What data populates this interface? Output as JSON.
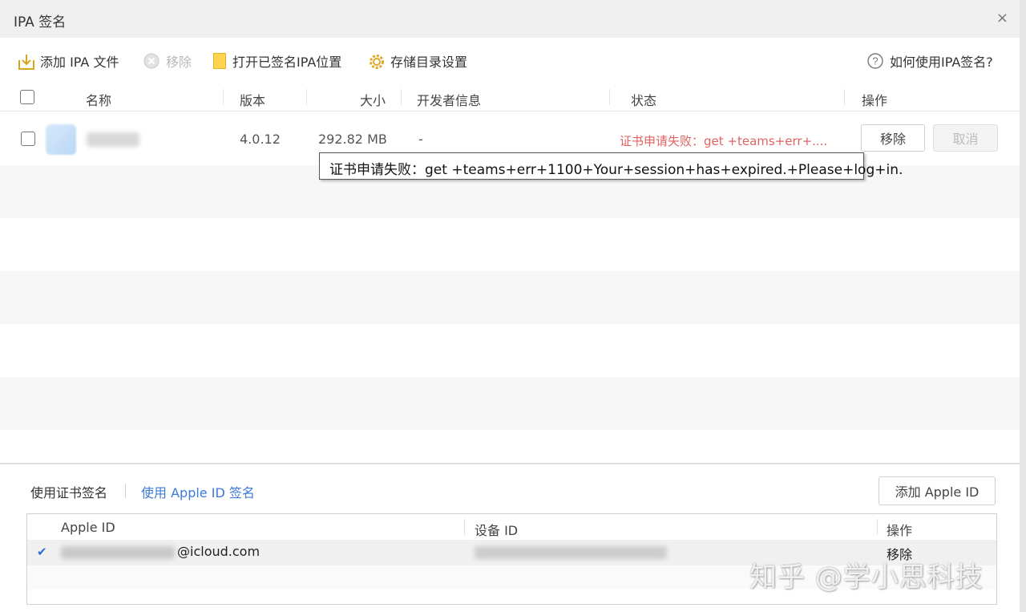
{
  "window": {
    "title": "IPA 签名",
    "close_glyph": "×"
  },
  "toolbar": {
    "add_ipa": "添加 IPA 文件",
    "remove": "移除",
    "open_signed_location": "打开已签名IPA位置",
    "storage_settings": "存储目录设置",
    "help": "如何使用IPA签名?"
  },
  "table": {
    "headers": {
      "name": "名称",
      "version": "版本",
      "size": "大小",
      "developer": "开发者信息",
      "status": "状态",
      "actions": "操作"
    },
    "rows": [
      {
        "version": "4.0.12",
        "size": "292.82 MB",
        "developer": "-",
        "status": "证书申请失败：get +teams+err+....",
        "remove_label": "移除",
        "cancel_label": "取消"
      }
    ]
  },
  "tooltip": {
    "text": "证书申请失败：get +teams+err+1100+Your+session+has+expired.+Please+log+in."
  },
  "signing": {
    "tab_certificate": "使用证书签名",
    "tab_apple_id": "使用 Apple ID 签名",
    "add_apple_id": "添加 Apple ID",
    "headers": {
      "apple_id": "Apple ID",
      "device_id": "设备 ID",
      "actions": "操作"
    },
    "rows": [
      {
        "check": "✔",
        "email_domain": "@icloud.com",
        "remove_label": "移除"
      }
    ]
  },
  "watermark": {
    "text": "知乎 @学小思科技"
  },
  "colors": {
    "accent_blue": "#3c7ad6",
    "error_red": "#e06262",
    "folder_yellow": "#ffd34d"
  }
}
